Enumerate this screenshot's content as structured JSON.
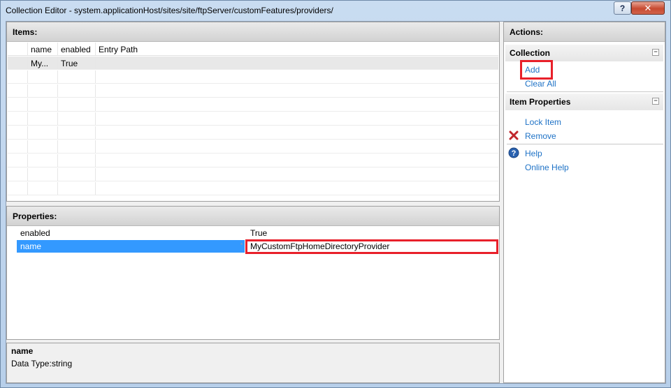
{
  "window": {
    "title": "Collection Editor - system.applicationHost/sites/site/ftpServer/customFeatures/providers/",
    "help_glyph": "?",
    "close_glyph": "✕"
  },
  "items": {
    "header": "Items:",
    "columns": [
      "name",
      "enabled",
      "Entry Path"
    ],
    "rows": [
      {
        "name": "My...",
        "enabled": "True",
        "entry_path": ""
      }
    ]
  },
  "properties": {
    "header": "Properties:",
    "rows": [
      {
        "name": "enabled",
        "value": "True"
      },
      {
        "name": "name",
        "value": "MyCustomFtpHomeDirectoryProvider"
      }
    ],
    "edited_marker": "*"
  },
  "description": {
    "title": "name",
    "text": "Data Type:string"
  },
  "actions": {
    "header": "Actions:",
    "collection": {
      "title": "Collection",
      "collapse_glyph": "−",
      "links": [
        "Add",
        "Clear All"
      ]
    },
    "item_properties": {
      "title": "Item Properties",
      "collapse_glyph": "−",
      "links": [
        "Lock Item",
        "Remove"
      ]
    },
    "help_links": [
      "Help",
      "Online Help"
    ]
  },
  "colors": {
    "link": "#1e72c6",
    "selection": "#3399ff",
    "highlight_red": "#e8202a"
  }
}
